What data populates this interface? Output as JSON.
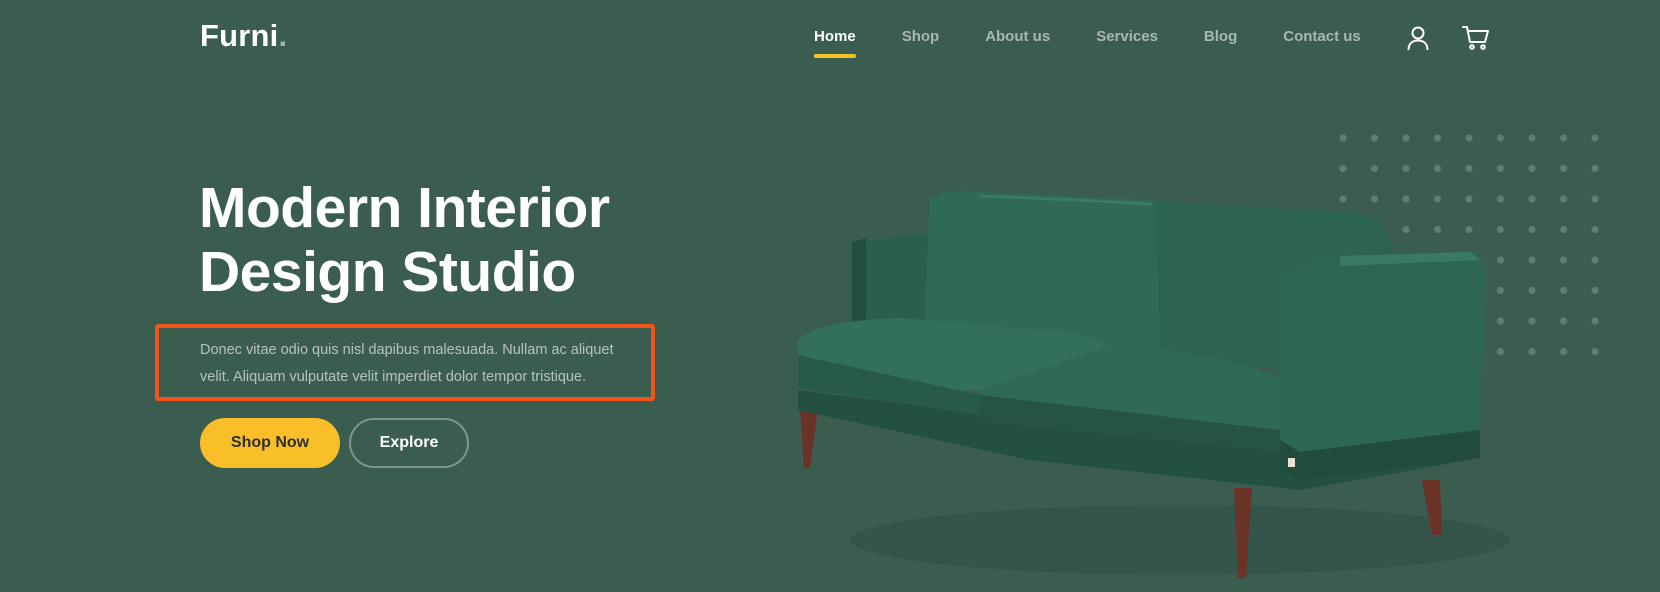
{
  "brand": {
    "name": "Furni",
    "dot": "."
  },
  "nav": {
    "items": [
      {
        "label": "Home",
        "active": true
      },
      {
        "label": "Shop",
        "active": false
      },
      {
        "label": "About us",
        "active": false
      },
      {
        "label": "Services",
        "active": false
      },
      {
        "label": "Blog",
        "active": false
      },
      {
        "label": "Contact us",
        "active": false
      }
    ],
    "icons": {
      "user": "user-icon",
      "cart": "cart-icon"
    }
  },
  "hero": {
    "title_line1": "Modern Interior",
    "title_line2": "Design Studio",
    "description": "Donec vitae odio quis nisl dapibus malesuada. Nullam ac aliquet velit. Aliquam vulputate velit imperdiet dolor tempor tristique.",
    "primary_button": "Shop Now",
    "secondary_button": "Explore"
  },
  "colors": {
    "background": "#3b5d50",
    "accent": "#f9bf29",
    "annotation": "#f0561a",
    "sofa": "#2f6a55"
  }
}
